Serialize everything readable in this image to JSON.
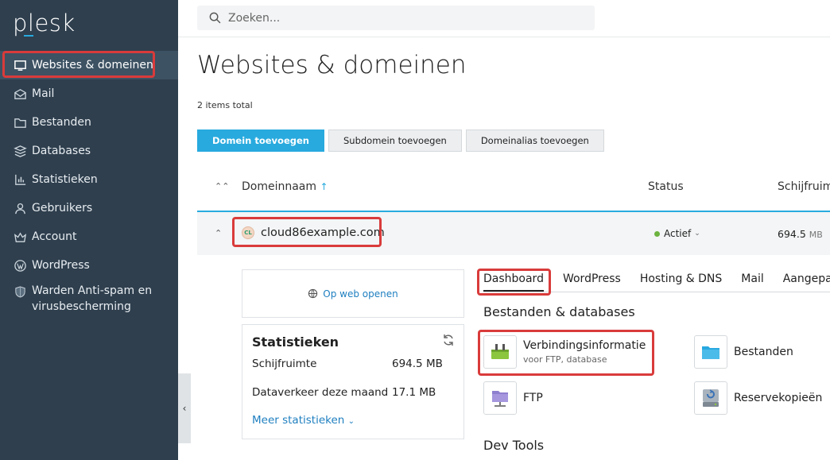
{
  "brand": {
    "logo_text": "plesk"
  },
  "sidebar": {
    "items": [
      {
        "label": "Websites & domeinen",
        "icon": "monitor-icon"
      },
      {
        "label": "Mail",
        "icon": "envelope-icon"
      },
      {
        "label": "Bestanden",
        "icon": "folder-icon"
      },
      {
        "label": "Databases",
        "icon": "database-icon"
      },
      {
        "label": "Statistieken",
        "icon": "chart-icon"
      },
      {
        "label": "Gebruikers",
        "icon": "user-icon"
      },
      {
        "label": "Account",
        "icon": "crown-icon"
      },
      {
        "label": "WordPress",
        "icon": "wordpress-icon"
      },
      {
        "label": "Warden Anti-spam en virusbescherming",
        "icon": "shield-icon"
      }
    ]
  },
  "search": {
    "placeholder": "Zoeken..."
  },
  "page": {
    "title": "Websites & domeinen",
    "items_total": "2 items total"
  },
  "toolbar": {
    "add_domain": "Domein toevoegen",
    "add_subdomain": "Subdomein toevoegen",
    "add_alias": "Domeinalias toevoegen"
  },
  "table": {
    "col_name": "Domeinnaam",
    "col_status": "Status",
    "col_disk": "Schijfruim",
    "row": {
      "domain": "cloud86example.com",
      "badge": "CL",
      "status": "Actief",
      "disk_value": "694.5",
      "disk_unit": "MB"
    }
  },
  "details": {
    "open_web": "Op web openen",
    "stats_title": "Statistieken",
    "stats": [
      {
        "label": "Schijfruimte",
        "value": "694.5 MB"
      },
      {
        "label": "Dataverkeer deze maand",
        "value": "17.1 MB"
      }
    ],
    "more_stats": "Meer statistieken",
    "tabs": [
      "Dashboard",
      "WordPress",
      "Hosting & DNS",
      "Mail",
      "Aangepas"
    ],
    "section_files": "Bestanden & databases",
    "tiles": {
      "connection": {
        "label": "Verbindingsinformatie",
        "sub": "voor FTP, database"
      },
      "files": {
        "label": "Bestanden"
      },
      "ftp": {
        "label": "FTP"
      },
      "backups": {
        "label": "Reservekopieën"
      }
    },
    "section_dev": "Dev Tools"
  },
  "colors": {
    "accent": "#28aade",
    "sidebar": "#2f3f4e",
    "highlight": "#d93b3b",
    "status_active": "#6cb33f"
  }
}
